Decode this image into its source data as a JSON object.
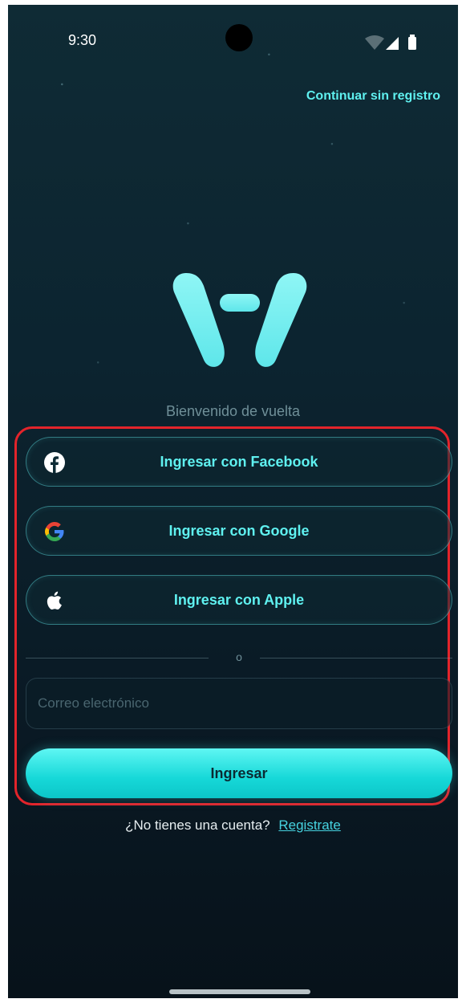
{
  "status_bar": {
    "time": "9:30"
  },
  "header": {
    "skip_label": "Continuar sin registro"
  },
  "brand": {
    "logo_icon": "brand-logo-icon",
    "accent_color": "#5ff1f0"
  },
  "welcome": {
    "text": "Bienvenido de vuelta"
  },
  "social_buttons": [
    {
      "label": "Ingresar con Facebook",
      "icon": "facebook-icon"
    },
    {
      "label": "Ingresar con Google",
      "icon": "google-icon"
    },
    {
      "label": "Ingresar con Apple",
      "icon": "apple-icon"
    }
  ],
  "divider": {
    "text": "o"
  },
  "email": {
    "value": "",
    "placeholder": "Correo electrónico"
  },
  "submit": {
    "label": "Ingresar"
  },
  "signup": {
    "prompt": "¿No tienes una cuenta?",
    "link": "Registrate"
  }
}
